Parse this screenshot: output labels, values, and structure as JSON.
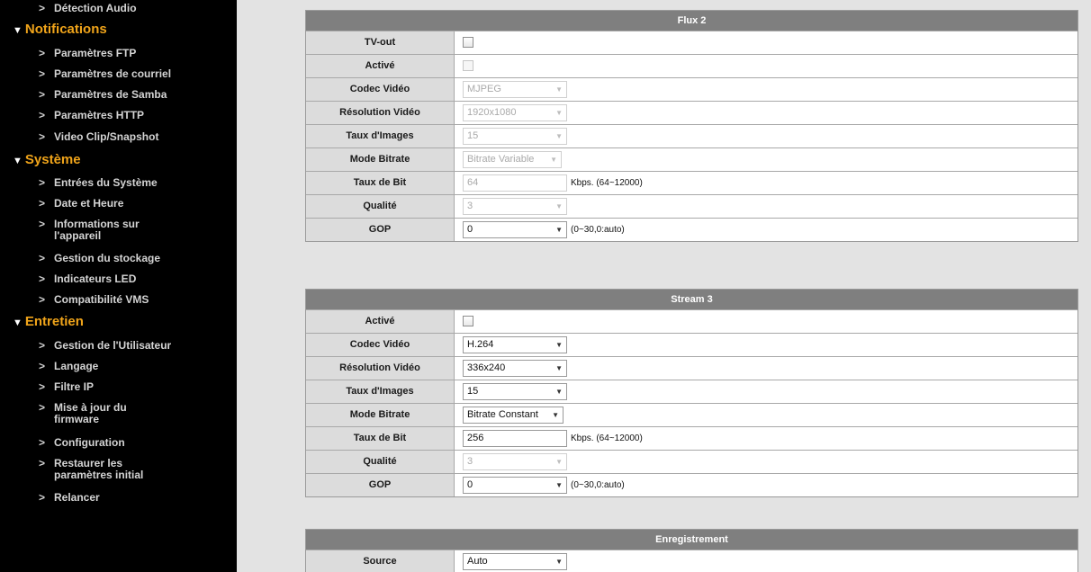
{
  "sidebar": {
    "top_item": "Détection Audio",
    "sections": [
      {
        "title": "Notifications",
        "items": [
          "Paramètres FTP",
          "Paramètres de courriel",
          "Paramètres de Samba",
          "Paramètres HTTP",
          "Video Clip/Snapshot"
        ]
      },
      {
        "title": "Système",
        "items": [
          "Entrées du Système",
          "Date et Heure",
          "Informations sur l'appareil",
          "Gestion du stockage",
          "Indicateurs LED",
          "Compatibilité VMS"
        ]
      },
      {
        "title": "Entretien",
        "items": [
          "Gestion de l'Utilisateur",
          "Langage",
          "Filtre IP",
          "Mise à jour du firmware",
          "Configuration",
          "Restaurer les paramètres initial",
          "Relancer"
        ]
      }
    ]
  },
  "flux2": {
    "title": "Flux 2",
    "labels": {
      "tv_out": "TV-out",
      "active": "Activé",
      "codec": "Codec Vidéo",
      "resolution": "Résolution Vidéo",
      "framerate": "Taux d'Images",
      "bitrate_mode": "Mode Bitrate",
      "bitrate": "Taux de Bit",
      "quality": "Qualité",
      "gop": "GOP"
    },
    "values": {
      "tv_out_checked": false,
      "active_checked": false,
      "codec": "MJPEG",
      "resolution": "1920x1080",
      "framerate": "15",
      "bitrate_mode": "Bitrate Variable",
      "bitrate": "64",
      "bitrate_unit": "Kbps. (64~12000)",
      "quality": "3",
      "gop": "0",
      "gop_hint": "(0~30,0:auto)"
    }
  },
  "stream3": {
    "title": "Stream 3",
    "labels": {
      "active": "Activé",
      "codec": "Codec Vidéo",
      "resolution": "Résolution Vidéo",
      "framerate": "Taux d'Images",
      "bitrate_mode": "Mode Bitrate",
      "bitrate": "Taux de Bit",
      "quality": "Qualité",
      "gop": "GOP"
    },
    "values": {
      "active_checked": false,
      "codec": "H.264",
      "resolution": "336x240",
      "framerate": "15",
      "bitrate_mode": "Bitrate Constant",
      "bitrate": "256",
      "bitrate_unit": "Kbps. (64~12000)",
      "quality": "3",
      "gop": "0",
      "gop_hint": "(0~30,0:auto)"
    }
  },
  "recording": {
    "title": "Enregistrement",
    "labels": {
      "source": "Source"
    },
    "values": {
      "source": "Auto"
    }
  },
  "colors": {
    "sidebar_bg": "#000000",
    "category_accent": "#f0a41a",
    "panel_header": "#7f7f7f",
    "label_cell": "#dcdcdc"
  },
  "icons": {
    "section_expand": "triangle-down-icon",
    "item_bullet": "chevron-right-icon",
    "select_arrow": "dropdown-arrow-icon"
  }
}
